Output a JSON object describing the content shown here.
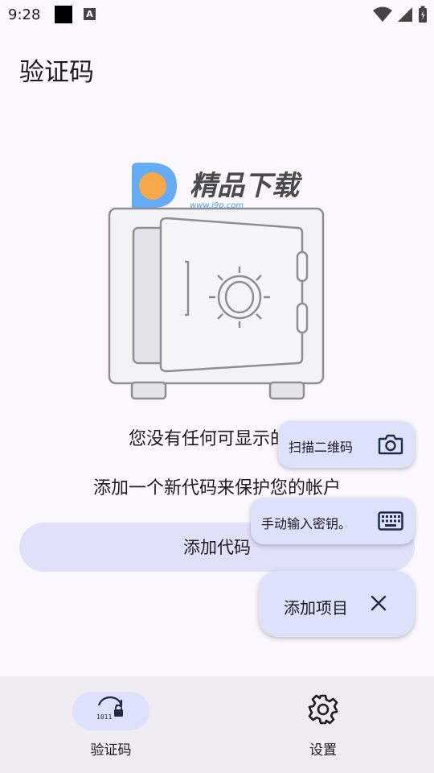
{
  "status_bar": {
    "time": "9:28",
    "a_glyph": "A"
  },
  "page_title": "验证码",
  "watermark": {
    "brand": "精品下载",
    "url": "www.i9p.com"
  },
  "empty_state": {
    "title": "您没有任何可显示的项",
    "subtitle": "添加一个新代码来保护您的帐户",
    "add_button": "添加代码"
  },
  "fab_menu": {
    "scan_qr_label": "扫描二维码",
    "manual_entry_label": "手动输入密钥。",
    "main_label": "添加项目"
  },
  "bottom_nav": {
    "items": [
      {
        "label": "验证码",
        "icon": "otp-lock-icon",
        "selected": true
      },
      {
        "label": "设置",
        "icon": "gear-icon",
        "selected": false
      }
    ]
  },
  "colors": {
    "background": "#fbf8fd",
    "accent_container": "#dde1fa",
    "button_tonal": "#dfe1f8",
    "nav_background": "#efecf2",
    "watermark_blue": "#4a9ff5",
    "watermark_orange": "#f5a94a"
  }
}
